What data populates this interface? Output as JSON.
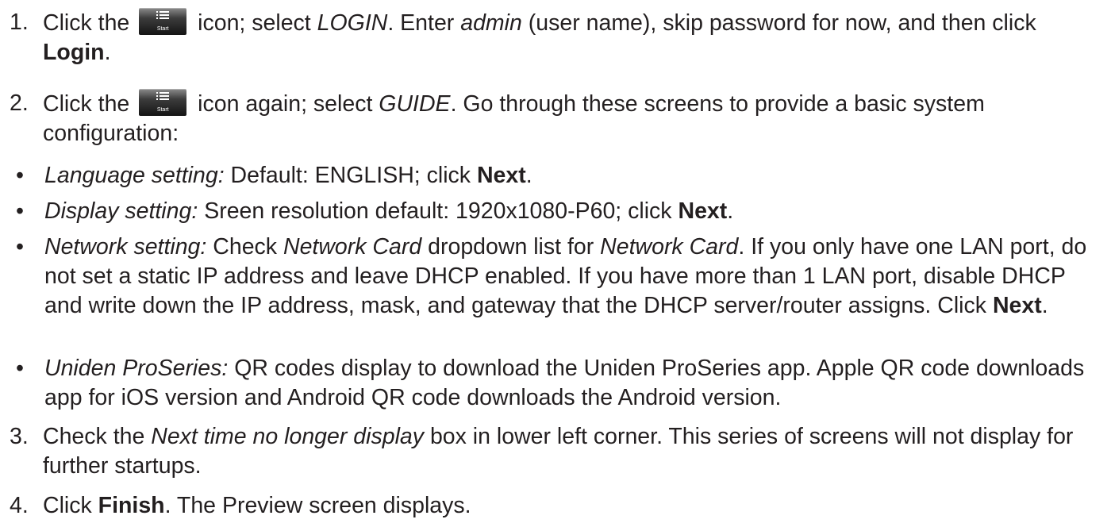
{
  "steps": [
    {
      "number": "1.",
      "t1": "Click the",
      "icon_caption": "Start",
      "t2": "icon; select",
      "i1": "LOGIN",
      "t3": ". Enter",
      "i2": "admin",
      "t4": "(user name), skip password for now, and then click",
      "b1": "Login",
      "t5": "."
    },
    {
      "number": "2.",
      "t1": "Click the",
      "icon_caption": "Start",
      "t2": "icon again; select",
      "i1": "GUIDE",
      "t3": ". Go through these screens to provide a basic system configuration:"
    },
    {
      "number": "3.",
      "t1": "Check the",
      "i1": "Next time no longer display",
      "t2": "box in lower left corner. This series of screens will not display for further startups."
    },
    {
      "number": "4.",
      "t1": "Click",
      "b1": "Finish",
      "t2": ". The Preview screen displays."
    }
  ],
  "bullets": [
    {
      "marker": "•",
      "i1": "Language setting:",
      "t1": "Default: ENGLISH; click",
      "b1": "Next",
      "t2": "."
    },
    {
      "marker": "•",
      "i1": "Display setting:",
      "t1": "Sreen resolution default: 1920x1080-P60; click",
      "b1": "Next",
      "t2": "."
    },
    {
      "marker": "•",
      "i1": "Network setting:",
      "t1": "Check",
      "i2": "Network Card",
      "t2": "dropdown list for",
      "i3": "Network Card",
      "t3": ". If you only have one LAN port, do not set a static IP address and leave DHCP enabled. If you have more than 1 LAN port, disable DHCP and write down the IP address, mask, and gateway that the DHCP server/router assigns. Click",
      "b1": "Next",
      "t4": "."
    },
    {
      "marker": "•",
      "i1": "Uniden ProSeries:",
      "t1": "QR codes display to download the Uniden ProSeries app. Apple QR code downloads app for iOS version and Android QR code downloads the Android version."
    }
  ]
}
